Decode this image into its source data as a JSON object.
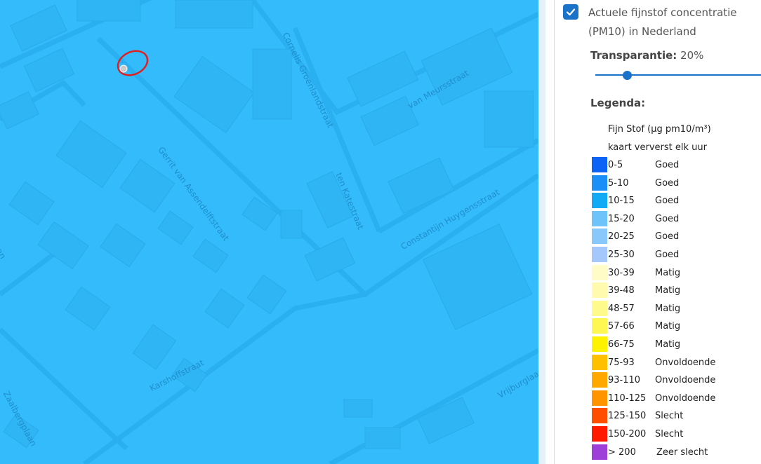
{
  "map": {
    "background_color": "#33bbfb",
    "street_color": "#1f8fcc",
    "streets": [
      "Cornelis Groenlandstraat",
      "van Meursstraat",
      "Gerrit van Assendelftstraat",
      "ten Katestraat",
      "Constantijn Huygensstraat",
      "Karshoffstraat",
      "Vrijburglaan",
      "Zaalbergplaan",
      "aan"
    ],
    "marker_color": "#e02020"
  },
  "panel": {
    "layer_checked": true,
    "layer_title": "Actuele fijnstof concentratie (PM10) in Nederland",
    "transparency_label": "Transparantie:",
    "transparency_value": "20%",
    "transparency_fraction": 0.2,
    "legend_title": "Legenda:",
    "legend_header_1": "Fijn Stof (µg pm10/m³)",
    "legend_header_2": "kaart ververst elk uur",
    "legend": [
      {
        "range": "0-5",
        "label": "Goed",
        "color": "#0d63f5"
      },
      {
        "range": "5-10",
        "label": "Goed",
        "color": "#1a8ff8"
      },
      {
        "range": "10-15",
        "label": "Goed",
        "color": "#13aaf5"
      },
      {
        "range": "15-20",
        "label": "Goed",
        "color": "#6ec4fa"
      },
      {
        "range": "20-25",
        "label": "Goed",
        "color": "#88c8fb"
      },
      {
        "range": "25-30",
        "label": "Goed",
        "color": "#a4c8fc"
      },
      {
        "range": "30-39",
        "label": "Matig",
        "color": "#fffcc8"
      },
      {
        "range": "39-48",
        "label": "Matig",
        "color": "#fffaae"
      },
      {
        "range": "48-57",
        "label": "Matig",
        "color": "#fffa8c"
      },
      {
        "range": "57-66",
        "label": "Matig",
        "color": "#fff751"
      },
      {
        "range": "66-75",
        "label": "Matig",
        "color": "#fff200"
      },
      {
        "range": "75-93",
        "label": "Onvoldoende",
        "color": "#ffc000"
      },
      {
        "range": "93-110",
        "label": "Onvoldoende",
        "color": "#ffa900"
      },
      {
        "range": "110-125",
        "label": "Onvoldoende",
        "color": "#ff9400"
      },
      {
        "range": "125-150",
        "label": "Slecht",
        "color": "#ff4e00"
      },
      {
        "range": "150-200",
        "label": "Slecht",
        "color": "#ff1a00"
      },
      {
        "range": "> 200",
        "label": "Zeer slecht",
        "color": "#9d3fd8"
      }
    ]
  }
}
